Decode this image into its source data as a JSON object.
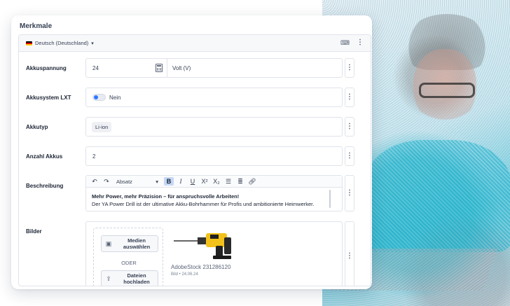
{
  "card": {
    "title": "Merkmale",
    "language": "Deutsch (Deutschland)"
  },
  "rows": {
    "akkuspannung": {
      "label": "Akkuspannung",
      "value": "24",
      "unit": "Volt (V)"
    },
    "akkusystem": {
      "label": "Akkusystem LXT",
      "toggle_label": "Nein",
      "toggle_on": false
    },
    "akkutyp": {
      "label": "Akkutyp",
      "chip": "Li-ion"
    },
    "anzahl": {
      "label": "Anzahl Akkus",
      "value": "2"
    },
    "beschreibung": {
      "label": "Beschreibung",
      "format": "Absatz",
      "headline": "Mehr Power, mehr Präzision – für anspruchsvolle Arbeiten!",
      "text": "Der YA Power Drill ist der ultimative Akku-Bohrhammer für Profis und ambitionierte Heimwerker."
    },
    "bilder": {
      "label": "Bilder",
      "select_media": "Medien auswählen",
      "oder": "ODER",
      "upload": "Dateien hochladen",
      "image_name": "AdobeStock 231286120",
      "image_meta": "Bild • 24.06.24"
    }
  },
  "colors": {
    "accent": "#2f78ff",
    "bold_active": "#c6d7f5",
    "drill_yellow": "#f2c21b"
  },
  "icons": [
    "flag-de-icon",
    "chevron-down-icon",
    "translate-icon",
    "kebab-icon",
    "calculator-icon",
    "undo-icon",
    "redo-icon",
    "bold-icon",
    "italic-icon",
    "underline-icon",
    "superscript-icon",
    "subscript-icon",
    "bullet-list-icon",
    "numbered-list-icon",
    "link-icon",
    "media-icon",
    "upload-icon"
  ]
}
